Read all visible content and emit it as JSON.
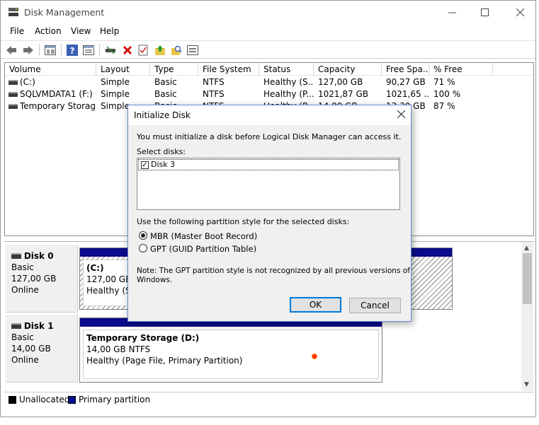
{
  "window": {
    "title": "Disk Management"
  },
  "menu": [
    "File",
    "Action",
    "View",
    "Help"
  ],
  "table": {
    "headers": [
      "Volume",
      "Layout",
      "Type",
      "File System",
      "Status",
      "Capacity",
      "Free Spa...",
      "% Free"
    ],
    "rows": [
      [
        "(C:)",
        "Simple",
        "Basic",
        "NTFS",
        "Healthy (S...",
        "127,00 GB",
        "90,27 GB",
        "71 %"
      ],
      [
        "SQLVMDATA1 (F:)",
        "Simple",
        "Basic",
        "NTFS",
        "Healthy (P...",
        "1021,87 GB",
        "1021,65 ...",
        "100 %"
      ],
      [
        "Temporary Storag...",
        "Simple",
        "Basic",
        "NTFS",
        "Healthy (P...",
        "14,00 GB",
        "13,30 GB",
        "87 %"
      ]
    ]
  },
  "disks": [
    {
      "name": "Disk 0",
      "type": "Basic",
      "size": "127,00 GB",
      "status": "Online",
      "partition": {
        "name": "(C:)",
        "size": "127,00 GB NTFS",
        "status": "Healthy (Sys"
      }
    },
    {
      "name": "Disk 1",
      "type": "Basic",
      "size": "14,00 GB",
      "status": "Online",
      "partition": {
        "name": "Temporary Storage  (D:)",
        "size": "14,00 GB NTFS",
        "status": "Healthy (Page File, Primary Partition)"
      }
    }
  ],
  "legend": [
    {
      "label": "Unallocated",
      "color": "#000000"
    },
    {
      "label": "Primary partition",
      "color": "#0a0a8c"
    }
  ],
  "dialog": {
    "title": "Initialize Disk",
    "intro": "You must initialize a disk before Logical Disk Manager can access it.",
    "select_label": "Select disks:",
    "disks": [
      {
        "label": "Disk 3",
        "checked": true
      }
    ],
    "style_label": "Use the following partition style for the selected disks:",
    "options": [
      {
        "label": "MBR (Master Boot Record)",
        "selected": true
      },
      {
        "label": "GPT (GUID Partition Table)",
        "selected": false
      }
    ],
    "note_line1": "Note: The GPT partition style is not recognized by all previous versions of",
    "note_line2": "Windows.",
    "ok": "OK",
    "cancel": "Cancel"
  },
  "colors": {
    "accent": "#0078d7",
    "partition_header": "#0a0a8c"
  }
}
